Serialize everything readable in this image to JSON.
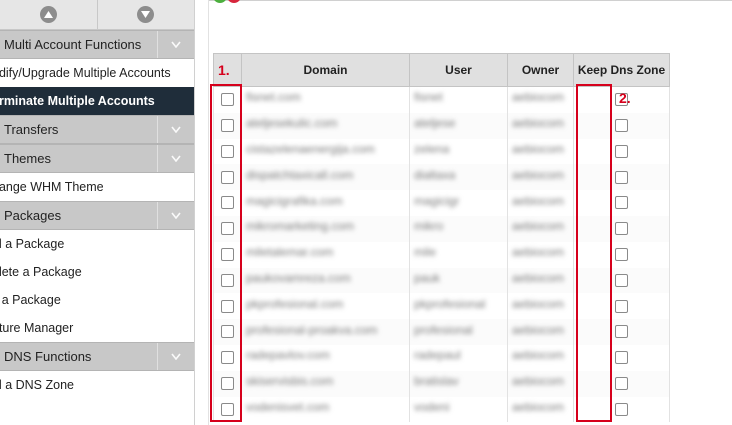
{
  "sidebar": {
    "sections": [
      {
        "label": "Multi Account Functions",
        "items": [
          {
            "label": "odify/Upgrade Multiple Accounts",
            "active": false
          },
          {
            "label": "erminate Multiple Accounts",
            "active": true
          }
        ]
      },
      {
        "label": "Transfers",
        "items": []
      },
      {
        "label": "Themes",
        "items": [
          {
            "label": "hange WHM Theme",
            "active": false
          }
        ]
      },
      {
        "label": "Packages",
        "items": [
          {
            "label": "ld a Package",
            "active": false
          },
          {
            "label": "elete a Package",
            "active": false
          },
          {
            "label": "it a Package",
            "active": false
          },
          {
            "label": "ature Manager",
            "active": false
          }
        ]
      },
      {
        "label": "DNS Functions",
        "items": [
          {
            "label": "ld a DNS Zone",
            "active": false
          }
        ]
      }
    ]
  },
  "table": {
    "headers": [
      "",
      "Domain",
      "User",
      "Owner",
      "Keep Dns Zone"
    ],
    "rows": [
      {
        "domain": "fisnet.com",
        "user": "fisnet",
        "owner": "aebiocom"
      },
      {
        "domain": "ateljesekulic.com",
        "user": "ateljese",
        "owner": "aebiocom"
      },
      {
        "domain": "cistazelenaenergija.com",
        "user": "zelena",
        "owner": "aebiocom"
      },
      {
        "domain": "dispatchtaxicall.com",
        "user": "dialtaxa",
        "owner": "aebiocom"
      },
      {
        "domain": "magicigrafika.com",
        "user": "magicigr",
        "owner": "aebiocom"
      },
      {
        "domain": "mikromarketing.com",
        "user": "mikro",
        "owner": "aebiocom"
      },
      {
        "domain": "miletalemar.com",
        "user": "mile",
        "owner": "aebiocom"
      },
      {
        "domain": "paukovamreza.com",
        "user": "pauk",
        "owner": "aebiocom"
      },
      {
        "domain": "pkprofesional.com",
        "user": "pkprofesional",
        "owner": "aebiocom"
      },
      {
        "domain": "profesional-proakva.com",
        "user": "profesional",
        "owner": "aebiocom"
      },
      {
        "domain": "radepavlov.com",
        "user": "radepaul",
        "owner": "aebiocom"
      },
      {
        "domain": "skiservisbis.com",
        "user": "bratislav",
        "owner": "aebiocom"
      },
      {
        "domain": "vodenisvet.com",
        "user": "vodeni",
        "owner": "aebiocom"
      }
    ]
  },
  "annotations": {
    "first": "1.",
    "second": "2."
  },
  "colors": {
    "annotation": "#d6001c",
    "active_item": "#1f2d3a",
    "section_bg": "#c8c8c8"
  },
  "icons": {
    "scroll_up": "chevron-up-circle-icon",
    "scroll_down": "chevron-down-circle-icon",
    "section_toggle": "chevron-down-icon"
  }
}
